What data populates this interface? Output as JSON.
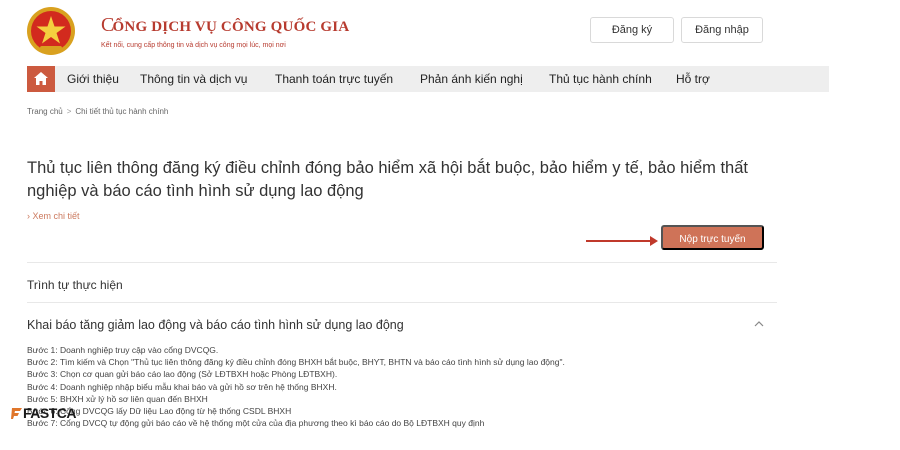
{
  "header": {
    "site_title": "CỔNG DỊCH VỤ CÔNG QUỐC GIA",
    "site_title_rest": "ỔNG DỊCH VỤ CÔNG QUỐC GIA",
    "site_title_first": "C",
    "tagline": "Kết nối, cung cấp thông tin và dịch vụ công mọi lúc, mọi nơi",
    "register_label": "Đăng ký",
    "login_label": "Đăng nhập"
  },
  "nav": {
    "items": [
      {
        "label": "Giới thiệu"
      },
      {
        "label": "Thông tin và dịch vụ"
      },
      {
        "label": "Thanh toán trực tuyến"
      },
      {
        "label": "Phản ánh kiến nghị"
      },
      {
        "label": "Thủ tục hành chính"
      },
      {
        "label": "Hỗ trợ"
      }
    ]
  },
  "breadcrumb": {
    "home": "Trang chủ",
    "current": "Chi tiết thủ tục hành chính"
  },
  "page": {
    "title": "Thủ tục liên thông đăng ký điều chỉnh đóng bảo hiểm xã hội bắt buộc, bảo hiểm y tế, bảo hiểm thất nghiệp và báo cáo tình hình sử dụng lao động",
    "detail_link": "Xem chi tiết",
    "submit_label": "Nộp trực tuyến",
    "section_title": "Trình tự thực hiện",
    "subsection_title": "Khai báo tăng giảm lao động và báo cáo tình hình sử dụng lao động",
    "steps": [
      "Bước 1: Doanh nghiệp truy cập vào cổng DVCQG.",
      "Bước 2: Tìm kiếm và Chọn \"Thủ tục liên thông đăng ký điều chỉnh đóng BHXH bắt buộc, BHYT, BHTN và báo cáo tình hình sử dụng lao động\".",
      "Bước 3: Chọn cơ quan gửi báo cáo lao động (Sở LĐTBXH hoặc Phòng LĐTBXH).",
      "Bước 4: Doanh nghiệp nhập biểu mẫu khai báo và gửi hồ sơ trên hệ thống BHXH.",
      "Bước 5: BHXH xử lý hồ sơ liên quan đến BHXH",
      "Bước 6: Cổng DVCQG lấy Dữ liệu Lao động từ hệ thống CSDL BHXH",
      "Bước 7: Cổng DVCQ tự động gửi báo cáo về hệ thống một cửa của địa phương theo kì báo cáo do Bộ LĐTBXH quy định"
    ]
  },
  "watermark": {
    "text": "FASTCA"
  },
  "colors": {
    "brand_red": "#b73b2f",
    "accent_orange": "#cf7358",
    "nav_bg": "#eeeeee",
    "arrow_red": "#c0392b"
  }
}
